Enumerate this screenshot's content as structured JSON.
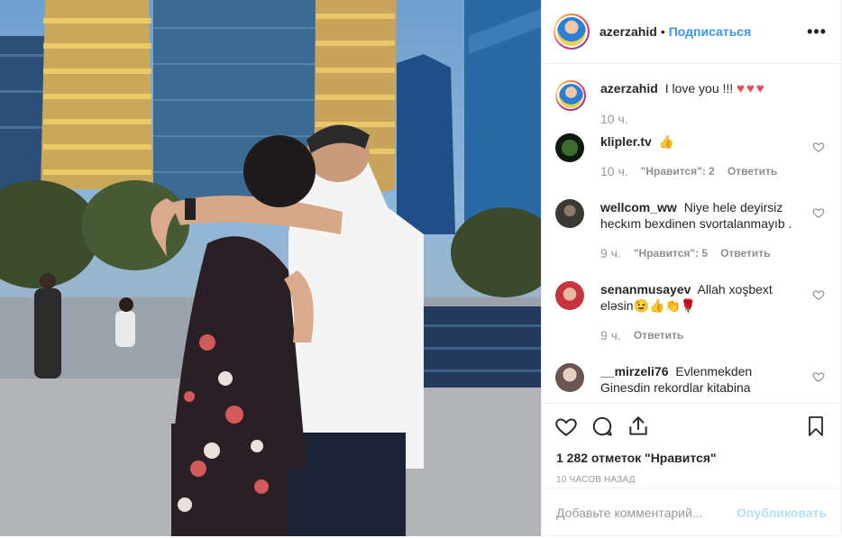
{
  "post": {
    "author": "azerzahid",
    "follow_label": "Подписаться",
    "more_icon": "more-dots-icon",
    "caption_text": "I love you !!!",
    "caption_hearts": "♥♥♥",
    "caption_time": "10 ч."
  },
  "comments": [
    {
      "user": "klipler.tv",
      "text": "👍",
      "time": "10 ч.",
      "likes": "\"Нравится\": 2",
      "reply": "Ответить"
    },
    {
      "user": "wellcom_ww",
      "text": "Niye hele deyirsiz heckım bexdinen svortalanmayıb .",
      "time": "9 ч.",
      "likes": "\"Нравится\": 5",
      "reply": "Ответить"
    },
    {
      "user": "senanmusayev",
      "text": "Allah xoşbext eləsin😉👍👏🌹",
      "time": "9 ч.",
      "reply": "Ответить"
    },
    {
      "user": "__mirzeli76",
      "text": "Evlenmekden Ginesdin rekordlar kitabina"
    }
  ],
  "actions": {
    "likes_count": "1 282 отметок \"Нравится\"",
    "posted_ago": "10 ЧАСОВ НАЗАД"
  },
  "add_comment": {
    "placeholder": "Добавьте комментарий...",
    "publish_label": "Опубликовать"
  },
  "colors": {
    "accent": "#3897f0",
    "like_red": "#ed4956",
    "publish_disabled": "#b2dffc"
  }
}
